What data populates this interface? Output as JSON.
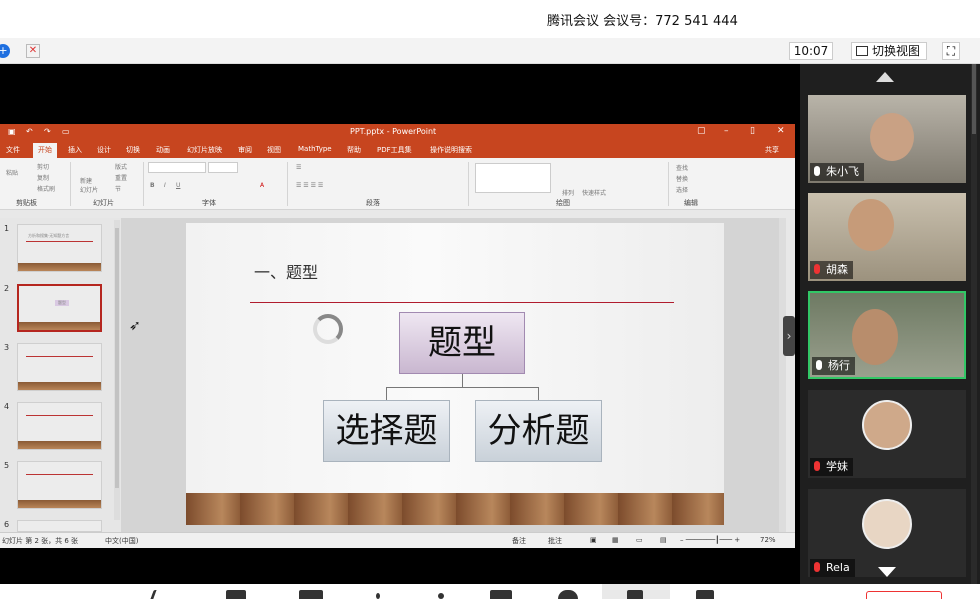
{
  "meeting": {
    "title": "腾讯会议 会议号：772 541 444",
    "time": "10:07",
    "switch_view": "切换视图"
  },
  "ppt": {
    "window_title": "PPT.pptx - PowerPoint",
    "tabs": [
      "文件",
      "开始",
      "插入",
      "设计",
      "切换",
      "动画",
      "幻灯片放映",
      "审阅",
      "视图",
      "MathType",
      "帮助",
      "PDF工具集"
    ],
    "tell_me": "操作说明搜索",
    "share": "共享",
    "ribbon_groups": [
      "剪贴板",
      "幻灯片",
      "字体",
      "段落",
      "绘图",
      "编辑"
    ],
    "ribbon_buttons": {
      "paste": "粘贴",
      "cut": "剪切",
      "copy": "复制",
      "format_painter": "格式刷",
      "new_slide": "新建\n幻灯片",
      "layout": "版式",
      "reset": "重置",
      "section": "节",
      "arrange": "排列",
      "quick_styles": "快速样式",
      "find": "查找",
      "replace": "替换",
      "select": "选择"
    },
    "slide_numbers": [
      "1",
      "2",
      "3",
      "4",
      "5",
      "6"
    ],
    "thumb_titles": [
      "方析和搜集·无知题方言",
      "题型",
      "",
      "",
      "",
      ""
    ],
    "slide": {
      "heading": "一、题型",
      "main_box": "题型",
      "left_box": "选择题",
      "right_box": "分析题"
    },
    "status": {
      "slide_info": "幻灯片 第 2 张，共 6 张",
      "language": "中文(中国)",
      "notes": "备注",
      "comments": "批注",
      "zoom": "72%"
    }
  },
  "participants": [
    {
      "name": "朱小飞",
      "mic": "on"
    },
    {
      "name": "胡森",
      "mic": "off"
    },
    {
      "name": "杨行",
      "mic": "on"
    },
    {
      "name": "学妹",
      "mic": "off"
    },
    {
      "name": "Rela",
      "mic": "off"
    }
  ]
}
